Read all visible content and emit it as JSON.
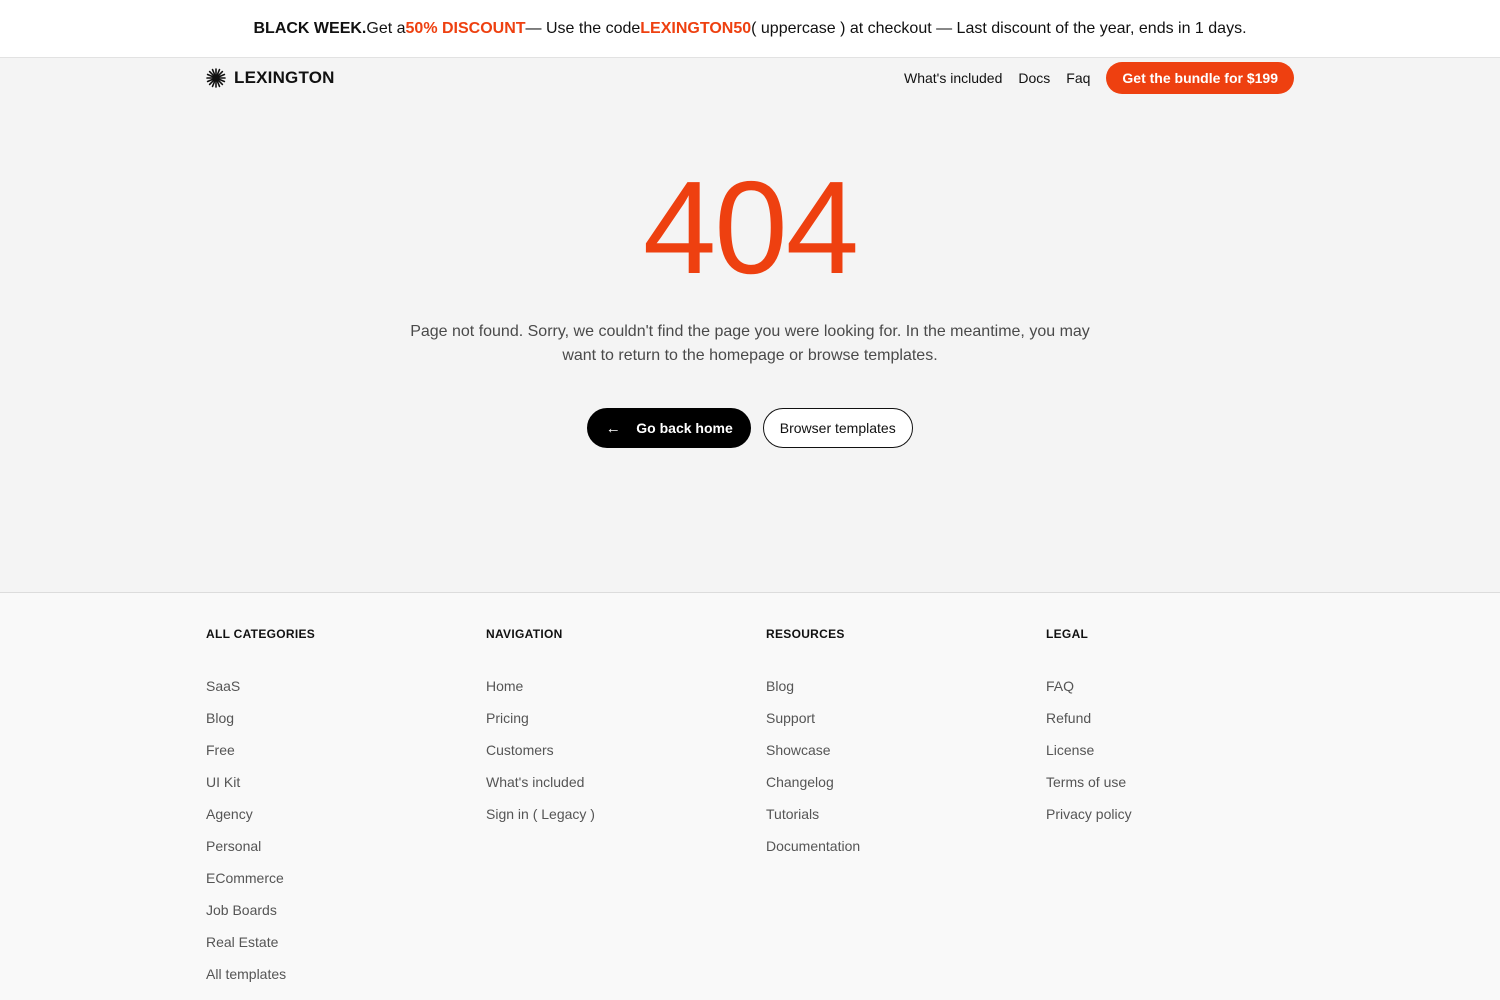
{
  "promo": {
    "lead": "BLACK WEEK.",
    "text1": " Get a ",
    "discount": "50% DISCOUNT",
    "text2": " — Use the code ",
    "code": "LEXINGTON50",
    "text3": " ( uppercase ) at checkout — Last discount of the year, ends in 1 days."
  },
  "header": {
    "logo_text": "LEXINGTON",
    "logo_icon": "sunburst-icon",
    "nav": [
      "What's included",
      "Docs",
      "Faq"
    ],
    "cta": "Get the bundle for $199"
  },
  "hero": {
    "code": "404",
    "message": "Page not found. Sorry, we couldn't find the page you were looking for. In the meantime, you may want to return to the homepage or browse templates.",
    "primary_button": "Go back home",
    "primary_icon": "arrow-left-icon",
    "secondary_button": "Browser templates"
  },
  "footer": {
    "columns": [
      {
        "title": "ALL CATEGORIES",
        "links": [
          "SaaS",
          "Blog",
          "Free",
          "UI Kit",
          "Agency",
          "Personal",
          "ECommerce",
          "Job Boards",
          "Real Estate",
          "All templates"
        ]
      },
      {
        "title": "NAVIGATION",
        "links": [
          "Home",
          "Pricing",
          "Customers",
          "What's included",
          "Sign in ( Legacy )"
        ]
      },
      {
        "title": "RESOURCES",
        "links": [
          "Blog",
          "Support",
          "Showcase",
          "Changelog",
          "Tutorials",
          "Documentation"
        ]
      },
      {
        "title": "LEGAL",
        "links": [
          "FAQ",
          "Refund",
          "License",
          "Terms of use",
          "Privacy policy"
        ]
      }
    ]
  },
  "colors": {
    "accent": "#ee4010",
    "background": "#f4f4f4",
    "footer_background": "#f9f9f9"
  }
}
